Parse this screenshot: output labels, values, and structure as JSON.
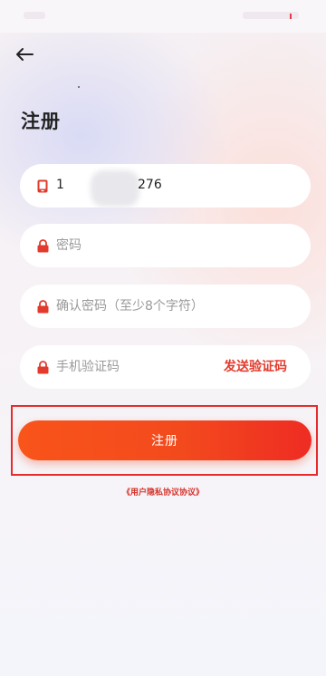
{
  "header": {
    "back_icon": "arrow-left-icon",
    "title": "注册"
  },
  "form": {
    "phone": {
      "icon": "phone-icon",
      "value_prefix": "1",
      "value_suffix": "276"
    },
    "password": {
      "icon": "lock-icon",
      "placeholder": "密码"
    },
    "confirm_password": {
      "icon": "lock-icon",
      "placeholder": "确认密码（至少8个字符）"
    },
    "sms_code": {
      "icon": "lock-icon",
      "placeholder": "手机验证码",
      "send_label": "发送验证码"
    }
  },
  "register_button_label": "注册",
  "agreement_link": "《用户隐私协议协议》",
  "colors": {
    "accent": "#ee2c23",
    "button_start": "#f9541a",
    "highlight_frame": "#e72b2b"
  }
}
